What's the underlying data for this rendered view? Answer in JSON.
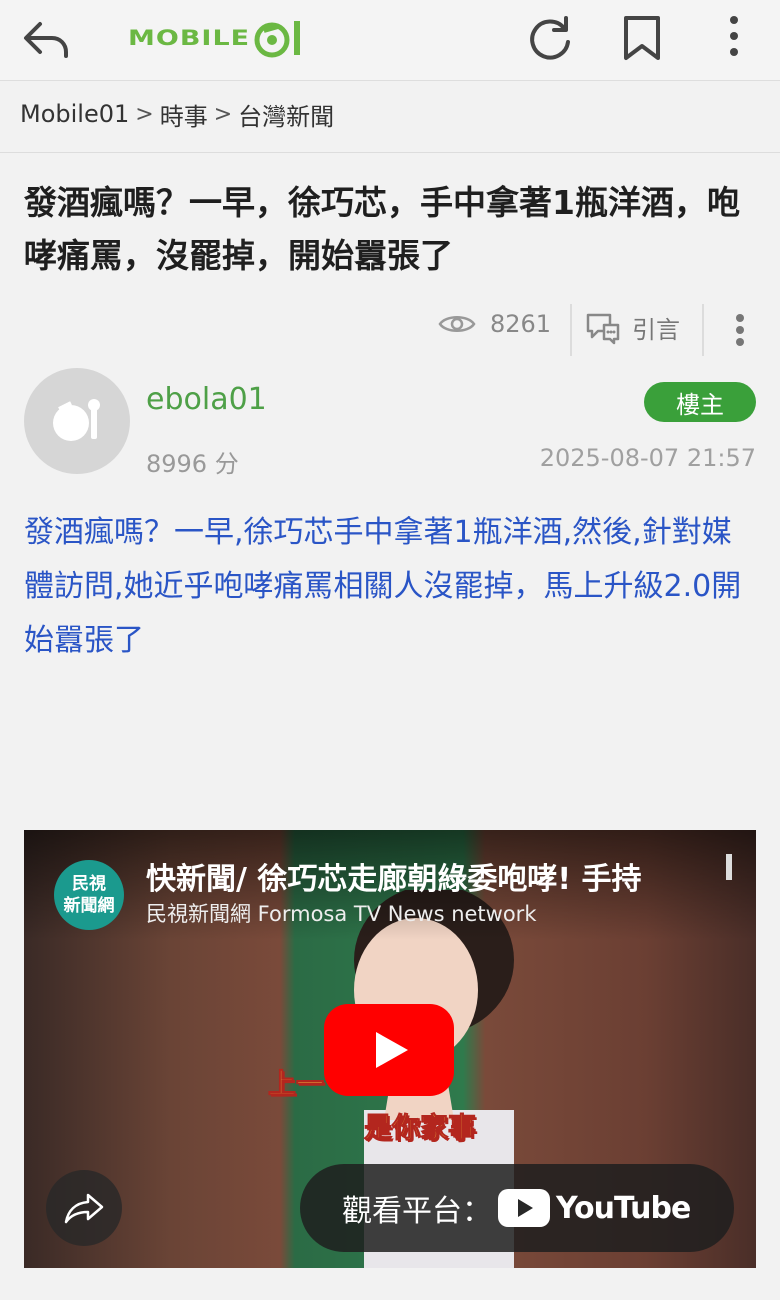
{
  "app": {
    "logo_text": "MOBILE",
    "brand_color": "#6bb843"
  },
  "breadcrumb": [
    "Mobile01",
    "時事",
    "台灣新聞"
  ],
  "post": {
    "title": "發酒瘋嗎？一早，徐巧芯，手中拿著1瓶洋酒，咆哮痛罵，沒罷掉，開始囂張了",
    "views": "8261",
    "quote_label": "引言",
    "author": {
      "username": "ebola01",
      "score": "8996 分",
      "badge": "樓主"
    },
    "timestamp": "2025-08-07 21:57",
    "body": "發酒瘋嗎？一早,徐巧芯手中拿著1瓶洋酒,然後,針對媒體訪問,她近乎咆哮痛罵相關人沒罷掉，馬上升級2.0開始囂張了",
    "link_color": "#2a55c6"
  },
  "video": {
    "title": "快新聞/ 徐巧芯走廊朝綠委咆哮! 手持",
    "channel": "民視新聞網 Formosa TV News network",
    "channel_logo": [
      "民視",
      "新聞網"
    ],
    "caption_line1": "上一",
    "caption_line2": "是你家事",
    "watch_on_label": "觀看平台：",
    "platform": "YouTube"
  },
  "icons": [
    "back-icon",
    "refresh-icon",
    "bookmark-icon",
    "more-vertical-icon",
    "eye-icon",
    "quote-icon",
    "play-icon",
    "share-icon",
    "youtube-icon"
  ]
}
